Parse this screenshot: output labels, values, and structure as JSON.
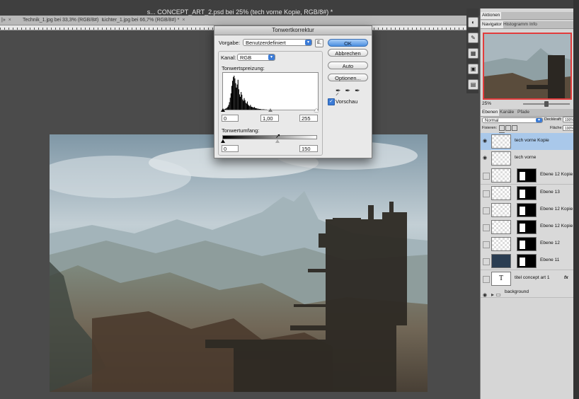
{
  "window": {
    "title": "s... CONCEPT_ART_2.psd bei 25% (tech vorne Kopie, RGB/8#) *"
  },
  "doc_tabs": [
    {
      "label": "Technik_1.jpg bei 33,3% (RGB/8#)",
      "close": "×"
    },
    {
      "label": "Lichter_1.jpg bei 66,7% (RGB/8#) *",
      "close": "×"
    }
  ],
  "dialog": {
    "title": "Tonwertkorrektur",
    "preset_label": "Vorgabe:",
    "preset_value": "Benutzerdefiniert",
    "preset_menu_glyph": "E,",
    "channel_label": "Kanal:",
    "channel_value": "RGB",
    "input_levels_label": "Tonwertspreizung:",
    "input_black": "0",
    "input_gamma": "1,00",
    "input_white": "255",
    "output_levels_label": "Tonwertumfang:",
    "output_black": "0",
    "output_white": "150",
    "buttons": {
      "ok": "OK",
      "reset": "Abbrechen",
      "auto": "Auto",
      "options": "Optionen..."
    },
    "preview_label": "Vorschau",
    "preview_checked": true,
    "histogram": [
      2,
      3,
      4,
      6,
      9,
      14,
      22,
      35,
      48,
      70,
      85,
      96,
      100,
      92,
      78,
      65,
      74,
      88,
      60,
      45,
      38,
      52,
      44,
      30,
      26,
      34,
      28,
      20,
      18,
      24,
      15,
      12,
      10,
      14,
      9,
      8,
      7,
      6,
      8,
      5,
      4,
      4,
      3,
      3,
      2,
      2,
      2,
      1,
      1,
      1,
      1,
      1,
      0,
      1,
      0,
      0
    ]
  },
  "panels": {
    "aktionen_tab": "Aktionen",
    "nav_tabs": [
      "Navigator",
      "Histogramm",
      "Info"
    ],
    "zoom": "25%",
    "layer_tabs": [
      "Ebenen",
      "Kanäle",
      "Pfade"
    ],
    "blend_mode": "Normal",
    "opacity_label": "Deckkraft:",
    "opacity_value": "100%",
    "lock_label": "Fixieren:",
    "fill_label": "Fläche:",
    "fill_value": "100%",
    "layers": [
      {
        "name": "tech vorne Kopie",
        "visible": true,
        "selected": true,
        "mask": false
      },
      {
        "name": "tech vorne",
        "visible": true,
        "selected": false,
        "mask": false
      },
      {
        "name": "Ebene 12 Kopie",
        "visible": false,
        "selected": false,
        "mask": true
      },
      {
        "name": "Ebene 13",
        "visible": false,
        "selected": false,
        "mask": true
      },
      {
        "name": "Ebene 12 Kopie 3",
        "visible": false,
        "selected": false,
        "mask": true
      },
      {
        "name": "Ebene 12 Kopie 2",
        "visible": false,
        "selected": false,
        "mask": true
      },
      {
        "name": "Ebene 12",
        "visible": false,
        "selected": false,
        "mask": true
      },
      {
        "name": "Ebene 11",
        "visible": false,
        "selected": false,
        "mask": true
      },
      {
        "name": "titel concept art 1",
        "visible": false,
        "selected": false,
        "mask": false,
        "type_glyph": "T",
        "fx": "fx"
      },
      {
        "name": "background",
        "visible": true,
        "selected": false,
        "mask": false,
        "group": true
      }
    ]
  },
  "colors": {
    "selection": "#a9c8ea",
    "ok_button": "#4b8fe0",
    "nav_frame": "#e23c3c"
  }
}
